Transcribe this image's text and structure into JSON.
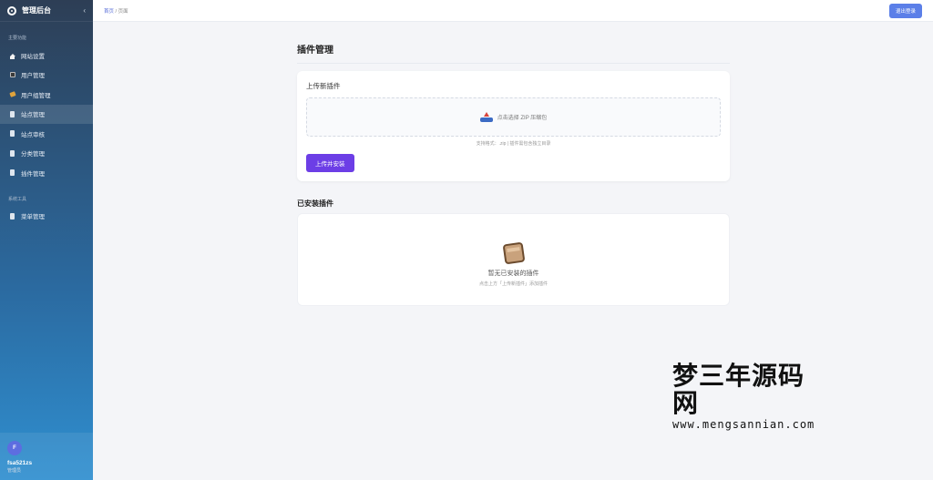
{
  "sidebar": {
    "brand_title": "管理后台",
    "collapse_icon": "‹",
    "group1_title": "主要功能",
    "group2_title": "系统工具",
    "items": [
      {
        "label": "网站设置",
        "icon": "home-icon"
      },
      {
        "label": "用户管理",
        "icon": "user-icon"
      },
      {
        "label": "用户组管理",
        "icon": "tag-icon"
      },
      {
        "label": "站点管理",
        "icon": "document-icon"
      },
      {
        "label": "站点审核",
        "icon": "document-icon"
      },
      {
        "label": "分类管理",
        "icon": "document-icon"
      },
      {
        "label": "插件管理",
        "icon": "document-icon"
      },
      {
        "label": "菜单管理",
        "icon": "document-icon"
      }
    ],
    "user": {
      "avatar_letter": "F",
      "name": "fsa521zs",
      "role": "管理员"
    }
  },
  "topbar": {
    "breadcrumb_home": "首页",
    "breadcrumb_sep": " / ",
    "breadcrumb_current": "页面",
    "logout_label": "退出登录"
  },
  "main": {
    "page_title": "插件管理",
    "upload_card": {
      "title": "上传新插件",
      "dropzone_text": "点击选择 ZIP 压缩包",
      "hint": "支持格式：.zip | 插件需包含独立目录",
      "button_label": "上传并安装"
    },
    "installed": {
      "title": "已安装插件",
      "empty_text": "暂无已安装的插件",
      "empty_sub": "点击上方「上传新插件」添加插件"
    }
  },
  "watermark": {
    "main": "梦三年源码网",
    "sub": "www.mengsannian.com"
  },
  "colors": {
    "accent": "#6c3ee6",
    "logout_button": "#5b7fe8",
    "sidebar_top": "#2d3e55",
    "sidebar_bottom": "#2f8fd0"
  }
}
